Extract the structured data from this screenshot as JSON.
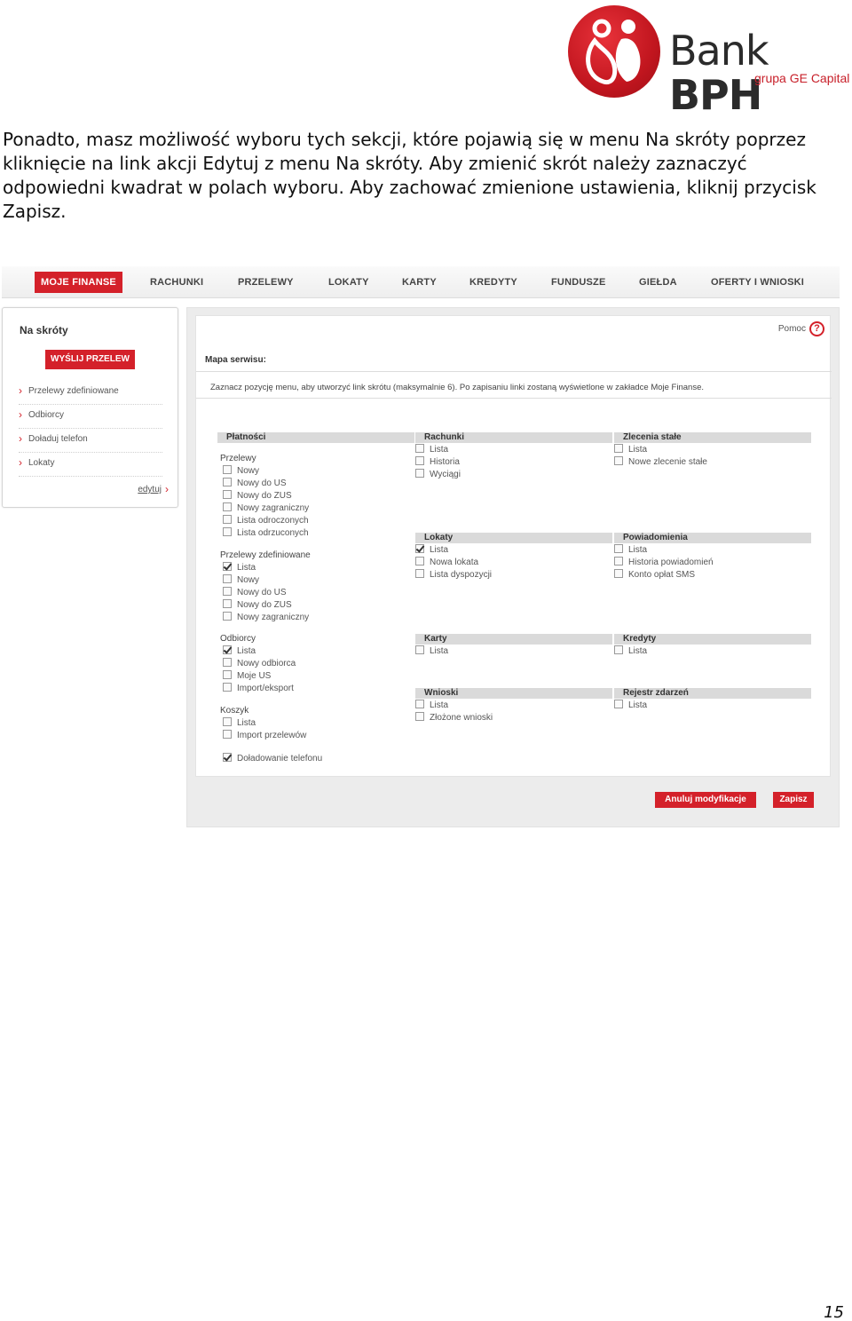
{
  "logo": {
    "name_regular": "Bank ",
    "name_bold": "BPH",
    "subtitle": "grupa GE Capital"
  },
  "intro_text": "Ponadto, masz możliwość wyboru tych sekcji, które pojawią się w menu Na skróty poprzez kliknięcie na link akcji Edytuj z menu Na skróty. Aby zmienić skrót należy zaznaczyć odpowiedni kwadrat w polach wyboru. Aby zachować zmienione ustawienia, kliknij przycisk Zapisz.",
  "nav": {
    "items": [
      "MOJE FINANSE",
      "RACHUNKI",
      "PRZELEWY",
      "LOKATY",
      "KARTY",
      "KREDYTY",
      "FUNDUSZE",
      "GIEŁDA",
      "OFERTY I WNIOSKI"
    ],
    "active_index": 0
  },
  "sidebar": {
    "title": "Na skróty",
    "send_button": "WYŚLIJ PRZELEW",
    "links": [
      "Przelewy zdefiniowane",
      "Odbiorcy",
      "Doładuj telefon",
      "Lokaty"
    ],
    "edit_link": "edytuj"
  },
  "main": {
    "help_label": "Pomoc",
    "help_icon": "?",
    "map_label": "Mapa serwisu:",
    "info_text": "Zaznacz pozycję menu, aby utworzyć link skrótu (maksymalnie 6). Po zapisaniu linki zostaną wyświetlone w zakładce Moje Finanse.",
    "sections": {
      "platnosci": {
        "title": "Płatności",
        "groups": [
          {
            "title": "Przelewy",
            "items": [
              {
                "label": "Nowy",
                "checked": false
              },
              {
                "label": "Nowy do US",
                "checked": false
              },
              {
                "label": "Nowy do ZUS",
                "checked": false
              },
              {
                "label": "Nowy zagraniczny",
                "checked": false
              },
              {
                "label": "Lista odroczonych",
                "checked": false
              },
              {
                "label": "Lista odrzuconych",
                "checked": false
              }
            ]
          },
          {
            "title": "Przelewy zdefiniowane",
            "items": [
              {
                "label": "Lista",
                "checked": true
              },
              {
                "label": "Nowy",
                "checked": false
              },
              {
                "label": "Nowy do US",
                "checked": false
              },
              {
                "label": "Nowy do ZUS",
                "checked": false
              },
              {
                "label": "Nowy zagraniczny",
                "checked": false
              }
            ]
          },
          {
            "title": "Odbiorcy",
            "items": [
              {
                "label": "Lista",
                "checked": true
              },
              {
                "label": "Nowy odbiorca",
                "checked": false
              },
              {
                "label": "Moje US",
                "checked": false
              },
              {
                "label": "Import/eksport",
                "checked": false
              }
            ]
          },
          {
            "title": "Koszyk",
            "items": [
              {
                "label": "Lista",
                "checked": false
              },
              {
                "label": "Import przelewów",
                "checked": false
              }
            ]
          },
          {
            "title": "",
            "items": [
              {
                "label": "Doładowanie telefonu",
                "checked": true
              }
            ]
          }
        ]
      },
      "rachunki": {
        "title": "Rachunki",
        "items": [
          {
            "label": "Lista",
            "checked": false
          },
          {
            "label": "Historia",
            "checked": false
          },
          {
            "label": "Wyciągi",
            "checked": false
          }
        ]
      },
      "zlecenia": {
        "title": "Zlecenia stałe",
        "items": [
          {
            "label": "Lista",
            "checked": false
          },
          {
            "label": "Nowe zlecenie stałe",
            "checked": false
          }
        ]
      },
      "lokaty": {
        "title": "Lokaty",
        "items": [
          {
            "label": "Lista",
            "checked": true
          },
          {
            "label": "Nowa lokata",
            "checked": false
          },
          {
            "label": "Lista dyspozycji",
            "checked": false
          }
        ]
      },
      "powiadomienia": {
        "title": "Powiadomienia",
        "items": [
          {
            "label": "Lista",
            "checked": false
          },
          {
            "label": "Historia powiadomień",
            "checked": false
          },
          {
            "label": "Konto opłat SMS",
            "checked": false
          }
        ]
      },
      "karty": {
        "title": "Karty",
        "items": [
          {
            "label": "Lista",
            "checked": false
          }
        ]
      },
      "kredyty": {
        "title": "Kredyty",
        "items": [
          {
            "label": "Lista",
            "checked": false
          }
        ]
      },
      "wnioski": {
        "title": "Wnioski",
        "items": [
          {
            "label": "Lista",
            "checked": false
          },
          {
            "label": "Złożone wnioski",
            "checked": false
          }
        ]
      },
      "rejestr": {
        "title": "Rejestr zdarzeń",
        "items": [
          {
            "label": "Lista",
            "checked": false
          }
        ]
      }
    },
    "cancel_button": "Anuluj modyfikacje",
    "save_button": "Zapisz"
  },
  "page_number": "15"
}
